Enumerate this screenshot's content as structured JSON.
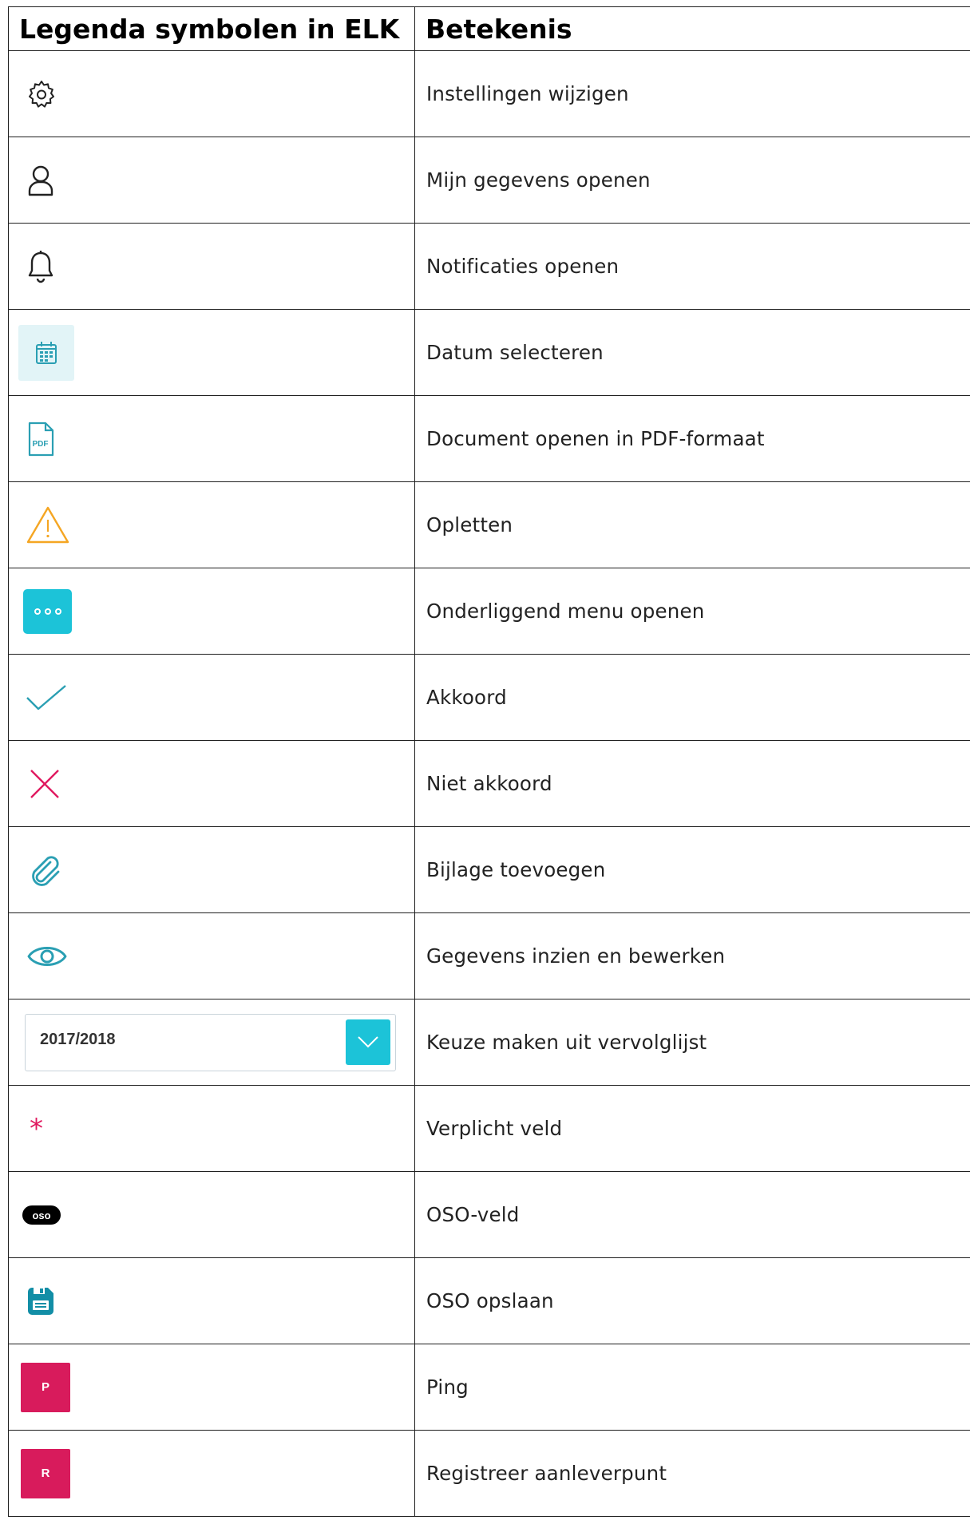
{
  "header": {
    "col_symbol": "Legenda symbolen in ELK",
    "col_meaning": "Betekenis"
  },
  "rows": [
    {
      "icon": "gear-icon",
      "meaning": "Instellingen wijzigen"
    },
    {
      "icon": "user-icon",
      "meaning": "Mijn gegevens openen"
    },
    {
      "icon": "bell-icon",
      "meaning": "Notificaties openen"
    },
    {
      "icon": "calendar-icon",
      "meaning": "Datum selecteren"
    },
    {
      "icon": "pdf-icon",
      "meaning": "Document openen in PDF-formaat"
    },
    {
      "icon": "warning-icon",
      "meaning": "Opletten"
    },
    {
      "icon": "more-menu-icon",
      "meaning": "Onderliggend menu openen"
    },
    {
      "icon": "check-icon",
      "meaning": "Akkoord"
    },
    {
      "icon": "cross-icon",
      "meaning": "Niet akkoord"
    },
    {
      "icon": "paperclip-icon",
      "meaning": "Bijlage toevoegen"
    },
    {
      "icon": "eye-icon",
      "meaning": "Gegevens inzien en bewerken"
    },
    {
      "icon": "dropdown-select",
      "meaning": "Keuze maken uit vervolglijst",
      "sample_value": "2017/2018"
    },
    {
      "icon": "asterisk-icon",
      "meaning": "Verplicht veld",
      "symbol_text": "*"
    },
    {
      "icon": "oso-badge-icon",
      "meaning": "OSO-veld",
      "symbol_text": "oso"
    },
    {
      "icon": "save-icon",
      "meaning": "OSO opslaan"
    },
    {
      "icon": "ping-button",
      "meaning": "Ping",
      "symbol_text": "P"
    },
    {
      "icon": "register-button",
      "meaning": "Registreer aanleverpunt",
      "symbol_text": "R"
    }
  ],
  "colors": {
    "accent_teal": "#1cc3d8",
    "icon_teal": "#2a9fb3",
    "warning_orange": "#f5a623",
    "error_pink": "#e0195f",
    "button_magenta": "#d81b5c",
    "border": "#1f1f1f"
  }
}
